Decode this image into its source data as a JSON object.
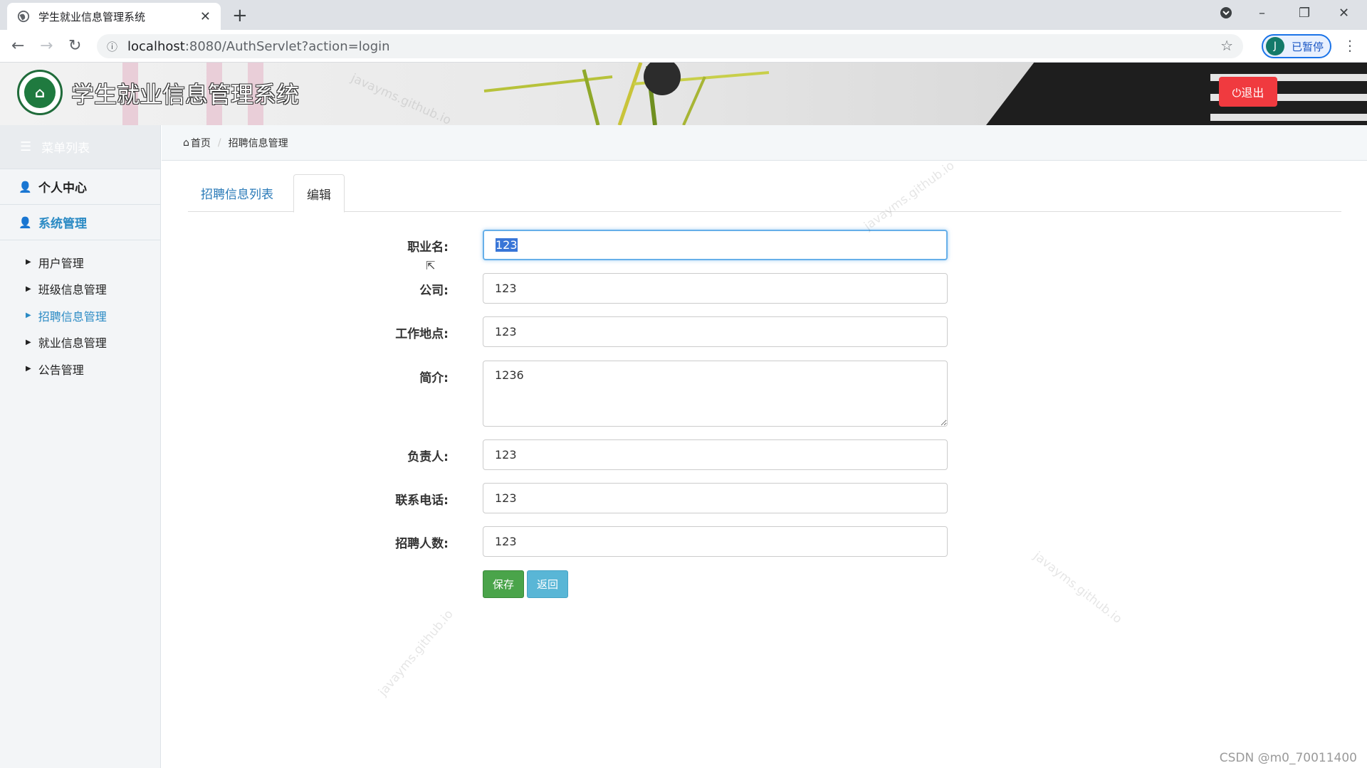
{
  "browser": {
    "tab_title": "学生就业信息管理系统",
    "tab_close": "✕",
    "new_tab": "+",
    "url_host": "localhost",
    "url_rest": ":8080/AuthServlet?action=login",
    "profile_initial": "J",
    "profile_status": "已暂停"
  },
  "header": {
    "system_title": "学生就业信息管理系统",
    "logout_label": "⏻退出"
  },
  "sidebar": {
    "menu_title": "菜单列表",
    "sections": [
      {
        "label": "个人中心"
      },
      {
        "label": "系统管理"
      }
    ],
    "items": [
      {
        "label": "用户管理"
      },
      {
        "label": "班级信息管理"
      },
      {
        "label": "招聘信息管理",
        "active": true
      },
      {
        "label": "就业信息管理"
      },
      {
        "label": "公告管理"
      }
    ]
  },
  "breadcrumb": {
    "home": "首页",
    "current": "招聘信息管理"
  },
  "tabs": {
    "list": "招聘信息列表",
    "edit": "编辑"
  },
  "form": {
    "job_name_label": "职业名:",
    "job_name_value": "123",
    "company_label": "公司:",
    "company_value": "123",
    "location_label": "工作地点:",
    "location_value": "123",
    "intro_label": "简介:",
    "intro_value": "1236",
    "contact_label": "负责人:",
    "contact_value": "123",
    "phone_label": "联系电话:",
    "phone_value": "123",
    "headcount_label": "招聘人数:",
    "headcount_value": "123",
    "save_label": "保存",
    "back_label": "返回"
  },
  "watermark_text": "javayms.github.io",
  "footer_credit": "CSDN @m0_70011400",
  "colors": {
    "accent": "#2a8ac4",
    "logout": "#f03a3f",
    "save": "#4aa44a",
    "back": "#59b6d6"
  }
}
